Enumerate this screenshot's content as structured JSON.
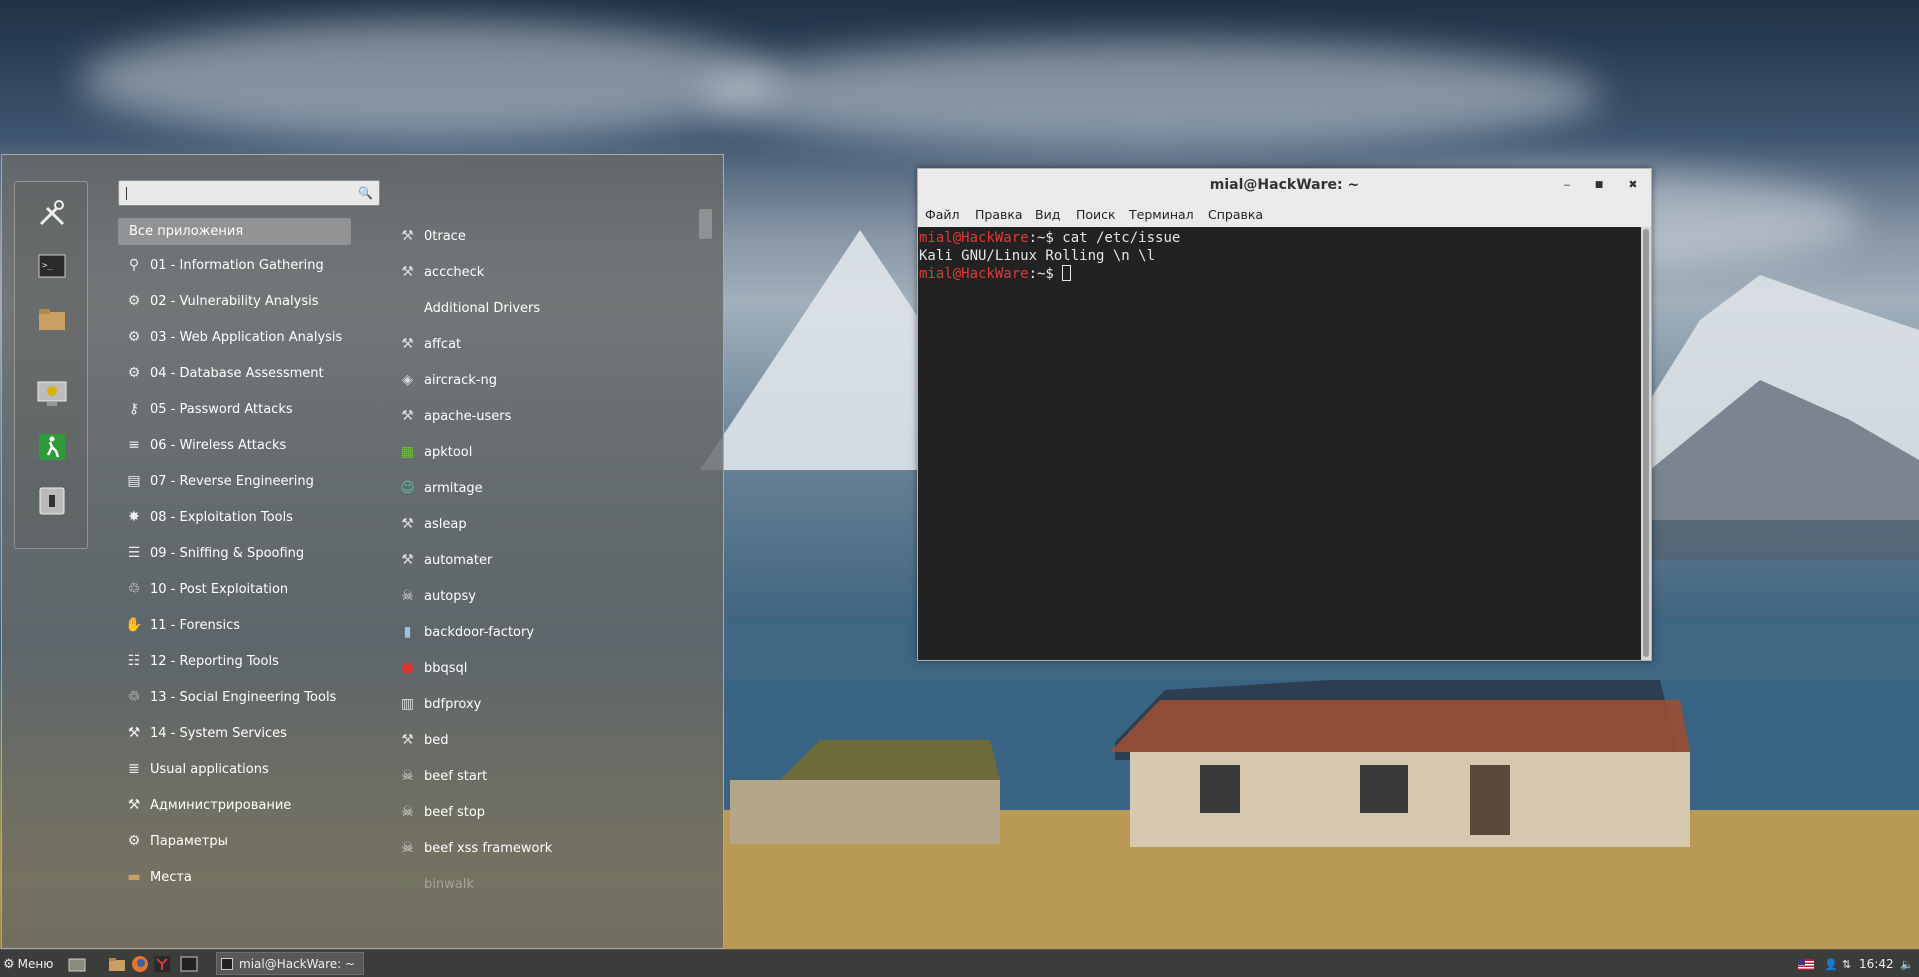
{
  "menu": {
    "search": {
      "placeholder": ""
    },
    "all_apps_label": "Все приложения",
    "favorites": [
      {
        "name": "tools-icon"
      },
      {
        "name": "terminal-icon"
      },
      {
        "name": "folder-icon"
      },
      {
        "name": "screensaver-icon"
      },
      {
        "name": "logout-icon"
      },
      {
        "name": "power-icon"
      }
    ],
    "categories": [
      {
        "label": "01 - Information Gathering",
        "icon": "magnifier-icon"
      },
      {
        "label": "02 - Vulnerability Analysis",
        "icon": "vuln-icon"
      },
      {
        "label": "03 - Web Application Analysis",
        "icon": "web-app-icon"
      },
      {
        "label": "04 - Database Assessment",
        "icon": "database-icon"
      },
      {
        "label": "05 - Password Attacks",
        "icon": "key-icon"
      },
      {
        "label": "06 - Wireless Attacks",
        "icon": "wireless-icon"
      },
      {
        "label": "07 - Reverse Engineering",
        "icon": "reverse-icon"
      },
      {
        "label": "08 - Exploitation Tools",
        "icon": "exploit-icon"
      },
      {
        "label": "09 - Sniffing & Spoofing",
        "icon": "sniff-icon"
      },
      {
        "label": "10 - Post Exploitation",
        "icon": "post-exploit-icon"
      },
      {
        "label": "11 - Forensics",
        "icon": "hand-icon"
      },
      {
        "label": "12 - Reporting Tools",
        "icon": "report-icon"
      },
      {
        "label": "13 - Social Engineering Tools",
        "icon": "social-icon"
      },
      {
        "label": "14 - System Services",
        "icon": "services-icon"
      },
      {
        "label": "Usual applications",
        "icon": "usual-apps-icon"
      },
      {
        "label": "Администрирование",
        "icon": "admin-icon"
      },
      {
        "label": "Параметры",
        "icon": "settings-icon"
      },
      {
        "label": "Места",
        "icon": "places-folder-icon"
      }
    ],
    "apps": [
      {
        "label": "0trace",
        "icon": "tool-icon"
      },
      {
        "label": "acccheck",
        "icon": "tool-icon"
      },
      {
        "label": "Additional Drivers",
        "icon": ""
      },
      {
        "label": "affcat",
        "icon": "tool-icon"
      },
      {
        "label": "aircrack-ng",
        "icon": "aircrack-icon"
      },
      {
        "label": "apache-users",
        "icon": "tool-icon"
      },
      {
        "label": "apktool",
        "icon": "apktool-icon"
      },
      {
        "label": "armitage",
        "icon": "armitage-icon"
      },
      {
        "label": "asleap",
        "icon": "tool-icon"
      },
      {
        "label": "automater",
        "icon": "tool-icon"
      },
      {
        "label": "autopsy",
        "icon": "autopsy-icon"
      },
      {
        "label": "backdoor-factory",
        "icon": "backdoor-icon"
      },
      {
        "label": "bbqsql",
        "icon": "bbqsql-icon"
      },
      {
        "label": "bdfproxy",
        "icon": "bdfproxy-icon"
      },
      {
        "label": "bed",
        "icon": "tool-icon"
      },
      {
        "label": "beef start",
        "icon": "beef-icon"
      },
      {
        "label": "beef stop",
        "icon": "beef-icon"
      },
      {
        "label": "beef xss framework",
        "icon": "beef-icon"
      },
      {
        "label": "binwalk",
        "icon": "binwalk-icon",
        "faded": true
      }
    ]
  },
  "terminal": {
    "title": "mial@HackWare: ~",
    "menubar": [
      "Файл",
      "Правка",
      "Вид",
      "Поиск",
      "Терминал",
      "Справка"
    ],
    "lines": [
      {
        "user": "mial@HackWare",
        "rest": ":~$ cat /etc/issue"
      },
      {
        "text": "Kali GNU/Linux Rolling \\n \\l"
      },
      {
        "user": "mial@HackWare",
        "rest": ":~$ "
      }
    ]
  },
  "taskbar": {
    "menu_label": "Меню",
    "launchers": [
      "show-desktop-icon",
      "files-icon",
      "firefox-icon",
      "metasploit-icon",
      "terminal-icon"
    ],
    "window_label": "mial@HackWare: ~",
    "clock": "16:42",
    "tray": [
      "us-flag-icon",
      "user-icon",
      "network-icon",
      "volume-icon"
    ]
  },
  "colors": {
    "prompt": "#e03a3a",
    "menu_bg": "#666866",
    "taskbar_bg": "#3b3d3b"
  }
}
